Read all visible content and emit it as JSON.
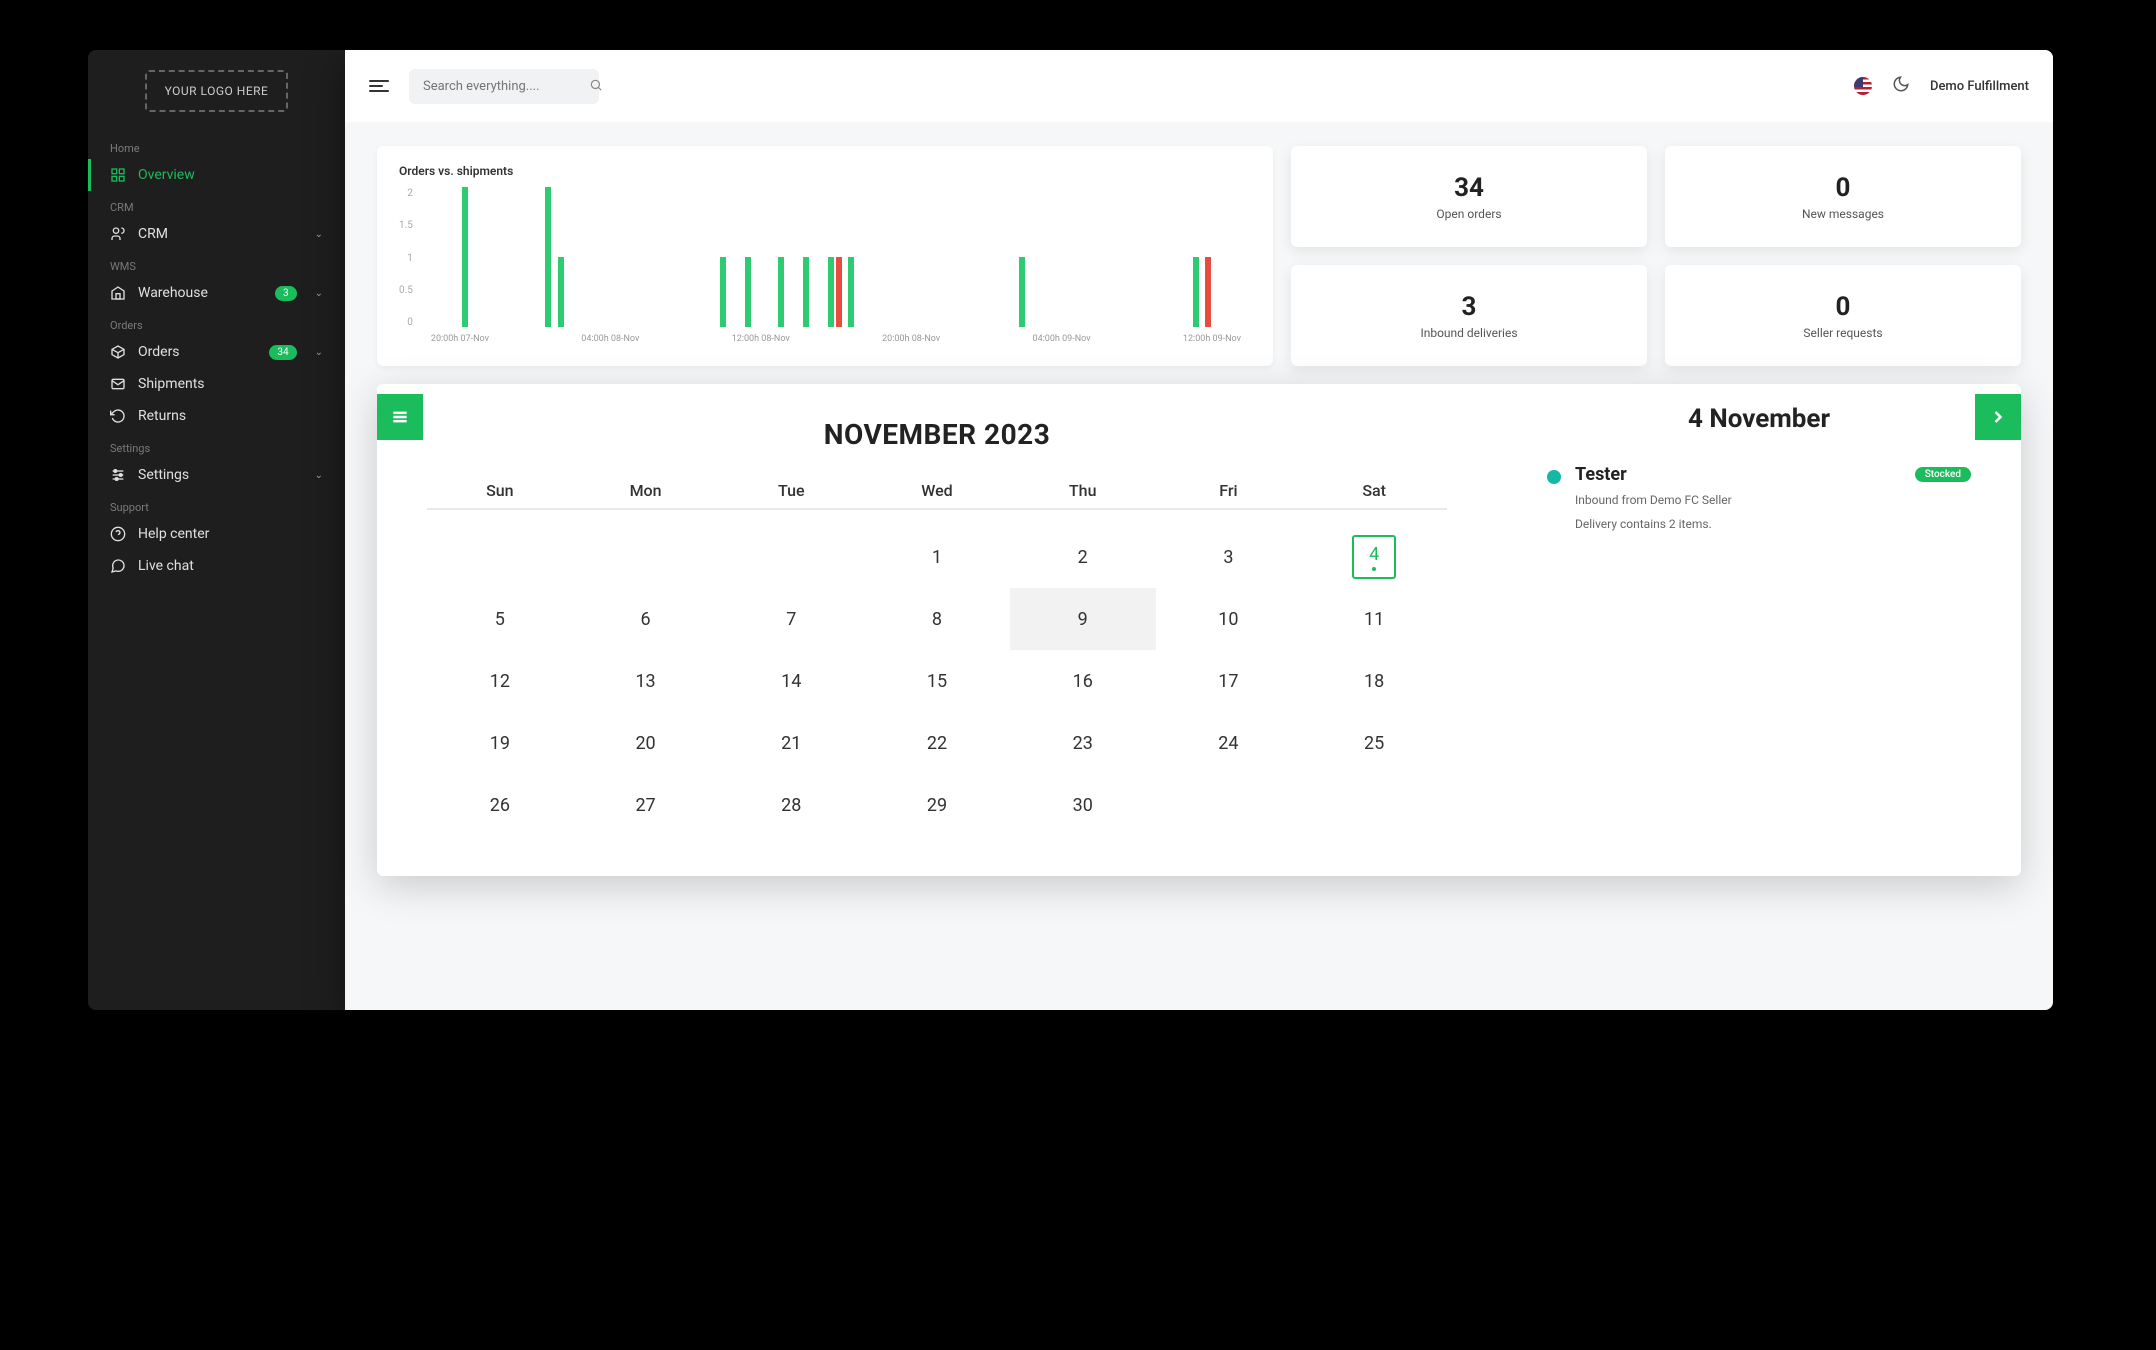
{
  "logo_text": "YOUR LOGO HERE",
  "sidebar": {
    "sections": [
      {
        "label": "Home",
        "items": [
          {
            "icon": "overview",
            "label": "Overview",
            "active": true
          }
        ]
      },
      {
        "label": "CRM",
        "items": [
          {
            "icon": "crm",
            "label": "CRM",
            "expandable": true
          }
        ]
      },
      {
        "label": "WMS",
        "items": [
          {
            "icon": "warehouse",
            "label": "Warehouse",
            "badge": "3",
            "expandable": true
          }
        ]
      },
      {
        "label": "Orders",
        "items": [
          {
            "icon": "orders",
            "label": "Orders",
            "badge": "34",
            "expandable": true
          },
          {
            "icon": "shipments",
            "label": "Shipments"
          },
          {
            "icon": "returns",
            "label": "Returns"
          }
        ]
      },
      {
        "label": "Settings",
        "items": [
          {
            "icon": "settings",
            "label": "Settings",
            "expandable": true
          }
        ]
      },
      {
        "label": "Support",
        "items": [
          {
            "icon": "help",
            "label": "Help center"
          },
          {
            "icon": "chat",
            "label": "Live chat"
          }
        ]
      }
    ]
  },
  "topbar": {
    "search_placeholder": "Search everything....",
    "user_label": "Demo Fulfillment"
  },
  "chart_data": {
    "type": "bar",
    "title": "Orders vs. shipments",
    "ylim": [
      0,
      2
    ],
    "yticks": [
      "2",
      "1.5",
      "1",
      "0.5",
      "0"
    ],
    "xticks": [
      "20:00h 07-Nov",
      "04:00h 08-Nov",
      "12:00h 08-Nov",
      "20:00h 08-Nov",
      "04:00h 09-Nov",
      "12:00h 09-Nov"
    ],
    "series": [
      {
        "name": "orders",
        "color": "#2ecc71",
        "points": [
          {
            "x_pct": 5,
            "value": 2
          },
          {
            "x_pct": 15,
            "value": 2
          },
          {
            "x_pct": 16.5,
            "value": 1
          },
          {
            "x_pct": 36,
            "value": 1
          },
          {
            "x_pct": 39,
            "value": 1
          },
          {
            "x_pct": 43,
            "value": 1
          },
          {
            "x_pct": 46,
            "value": 1
          },
          {
            "x_pct": 49,
            "value": 1
          },
          {
            "x_pct": 51.5,
            "value": 1
          },
          {
            "x_pct": 72,
            "value": 1
          },
          {
            "x_pct": 93,
            "value": 1
          }
        ]
      },
      {
        "name": "shipments",
        "color": "#e74c3c",
        "points": [
          {
            "x_pct": 50,
            "value": 1
          },
          {
            "x_pct": 94.5,
            "value": 1
          }
        ]
      }
    ]
  },
  "stats": [
    {
      "value": "34",
      "label": "Open orders"
    },
    {
      "value": "0",
      "label": "New messages"
    },
    {
      "value": "3",
      "label": "Inbound deliveries"
    },
    {
      "value": "0",
      "label": "Seller requests"
    }
  ],
  "calendar": {
    "title": "NOVEMBER 2023",
    "weekdays": [
      "Sun",
      "Mon",
      "Tue",
      "Wed",
      "Thu",
      "Fri",
      "Sat"
    ],
    "start_weekday": 3,
    "days_in_month": 30,
    "selected_day": 4,
    "today_day": 9
  },
  "event_panel": {
    "date_title": "4 November",
    "items": [
      {
        "title": "Tester",
        "badge": "Stocked",
        "line1": "Inbound from Demo FC Seller",
        "line2": "Delivery contains 2 items."
      }
    ]
  }
}
